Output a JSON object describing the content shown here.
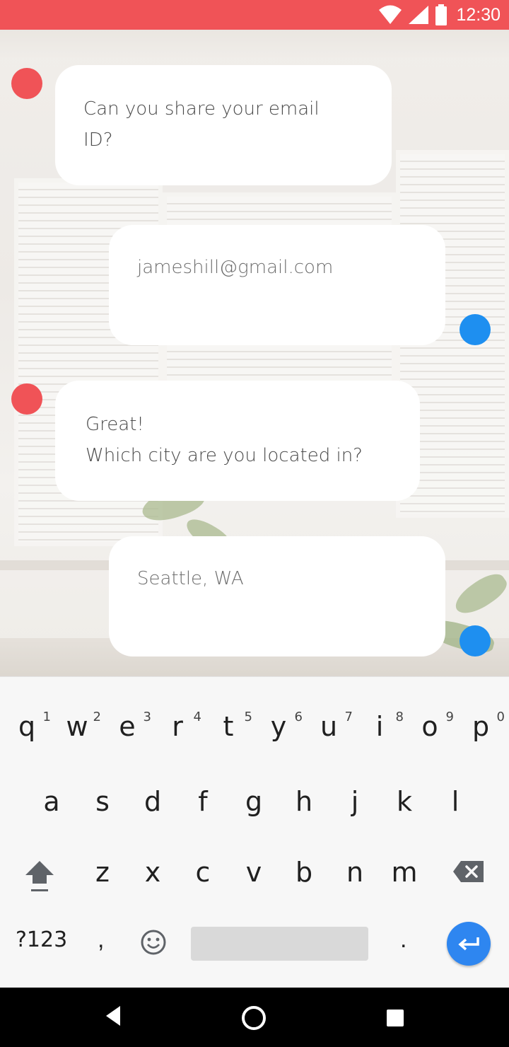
{
  "status_bar": {
    "time": "12:30",
    "color": "#f05357",
    "icons": [
      "wifi-icon",
      "signal-icon",
      "battery-icon"
    ]
  },
  "chat": {
    "messages": [
      {
        "sender": "bot",
        "lines": [
          "Can you share your email",
          "ID?"
        ]
      },
      {
        "sender": "user",
        "lines": [
          "jameshill@gmail.com"
        ]
      },
      {
        "sender": "bot",
        "lines": [
          "Great!",
          "Which city are you located in?"
        ]
      },
      {
        "sender": "user",
        "lines": [
          "Seattle, WA"
        ]
      }
    ],
    "bot_color": "#f05357",
    "user_color": "#1e8ff0"
  },
  "keyboard": {
    "row1": [
      {
        "key": "q",
        "hint": "1"
      },
      {
        "key": "w",
        "hint": "2"
      },
      {
        "key": "e",
        "hint": "3"
      },
      {
        "key": "r",
        "hint": "4"
      },
      {
        "key": "t",
        "hint": "5"
      },
      {
        "key": "y",
        "hint": "6"
      },
      {
        "key": "u",
        "hint": "7"
      },
      {
        "key": "i",
        "hint": "8"
      },
      {
        "key": "o",
        "hint": "9"
      },
      {
        "key": "p",
        "hint": "0"
      }
    ],
    "row2": [
      "a",
      "s",
      "d",
      "f",
      "g",
      "h",
      "j",
      "k",
      "l"
    ],
    "row3": [
      "z",
      "x",
      "c",
      "v",
      "b",
      "n",
      "m"
    ],
    "symbols_label": "?123",
    "comma": ",",
    "period": ".",
    "enter_color": "#2e86f0"
  },
  "nav_bar": {
    "icons": [
      "back-icon",
      "home-icon",
      "recents-icon"
    ]
  }
}
